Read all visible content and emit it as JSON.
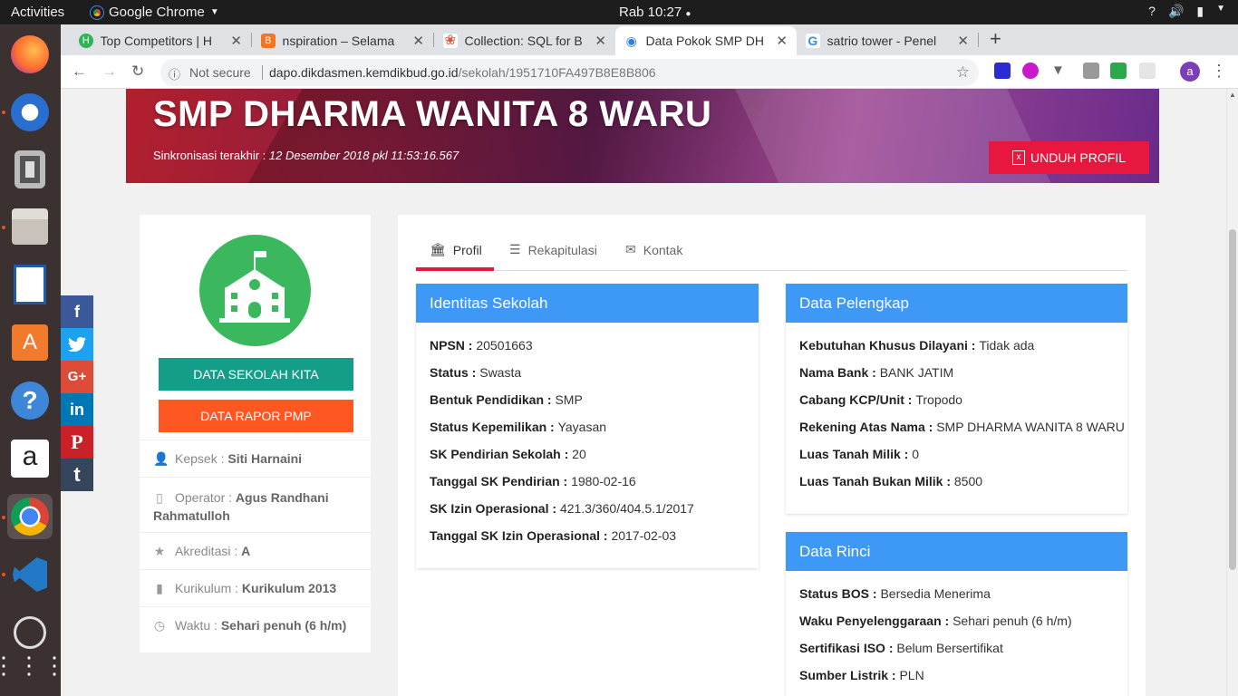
{
  "os": {
    "activities": "Activities",
    "app": "Google Chrome",
    "clock": "Rab 10:27"
  },
  "tabs": [
    {
      "label": "Top Competitors | H",
      "color": "#2cb457",
      "icon": "H"
    },
    {
      "label": "nspiration – Selama",
      "color": "#f47421",
      "icon": "B"
    },
    {
      "label": "Collection: SQL for B",
      "color": "#e0533b",
      "icon": "❀"
    },
    {
      "label": "Data Pokok SMP DH",
      "color": "#2f7de1",
      "icon": "◉"
    },
    {
      "label": "satrio tower - Penel",
      "color": "#4285f4",
      "icon": "G"
    }
  ],
  "omnibox": {
    "security": "Not secure",
    "domain": "dapo.dikdasmen.kemdikbud.go.id",
    "path": "/sekolah/1951710FA497B8E8B806"
  },
  "avatar": "a",
  "hero": {
    "title": "SMP DHARMA WANITA 8 WARU",
    "sync_label": "Sinkronisasi terakhir : ",
    "sync_value": "12 Desember 2018 pkl 11:53:16.567",
    "download": "UNDUH PROFIL"
  },
  "sidebar": {
    "btn_kita": "DATA SEKOLAH KITA",
    "btn_kita_color": "#149e8a",
    "btn_rapor": "DATA RAPOR PMP",
    "btn_rapor_color": "#ff5722",
    "items": [
      {
        "label": "Kepsek : ",
        "value": "Siti Harnaini",
        "icon": "user-icon"
      },
      {
        "label": "Operator : ",
        "value": "Agus Randhani Rahmatulloh",
        "icon": "mobile-icon"
      },
      {
        "label": "Akreditasi : ",
        "value": "A",
        "icon": "star-icon"
      },
      {
        "label": "Kurikulum : ",
        "value": "Kurikulum 2013",
        "icon": "book-icon"
      },
      {
        "label": "Waktu : ",
        "value": "Sehari penuh (6 h/m)",
        "icon": "clock-icon"
      }
    ]
  },
  "main_tabs": [
    {
      "label": "Profil"
    },
    {
      "label": "Rekapitulasi"
    },
    {
      "label": "Kontak"
    }
  ],
  "identitas": {
    "title": "Identitas Sekolah",
    "rows": [
      {
        "k": "NPSN : ",
        "v": "20501663"
      },
      {
        "k": "Status : ",
        "v": "Swasta"
      },
      {
        "k": "Bentuk Pendidikan : ",
        "v": "SMP"
      },
      {
        "k": "Status Kepemilikan : ",
        "v": "Yayasan"
      },
      {
        "k": "SK Pendirian Sekolah : ",
        "v": "20"
      },
      {
        "k": "Tanggal SK Pendirian : ",
        "v": "1980-02-16"
      },
      {
        "k": "SK Izin Operasional : ",
        "v": "421.3/360/404.5.1/2017"
      },
      {
        "k": "Tanggal SK Izin Operasional : ",
        "v": "2017-02-03"
      }
    ]
  },
  "pelengkap": {
    "title": "Data Pelengkap",
    "rows": [
      {
        "k": "Kebutuhan Khusus Dilayani : ",
        "v": "Tidak ada"
      },
      {
        "k": "Nama Bank : ",
        "v": "BANK JATIM"
      },
      {
        "k": "Cabang KCP/Unit : ",
        "v": "Tropodo"
      },
      {
        "k": "Rekening Atas Nama : ",
        "v": "SMP DHARMA WANITA 8 WARU"
      },
      {
        "k": "Luas Tanah Milik : ",
        "v": "0"
      },
      {
        "k": "Luas Tanah Bukan Milik : ",
        "v": "8500"
      }
    ]
  },
  "rinci": {
    "title": "Data Rinci",
    "rows": [
      {
        "k": "Status BOS : ",
        "v": "Bersedia Menerima"
      },
      {
        "k": "Waku Penyelenggaraan : ",
        "v": "Sehari penuh (6 h/m)"
      },
      {
        "k": "Sertifikasi ISO : ",
        "v": "Belum Bersertifikat"
      },
      {
        "k": "Sumber Listrik : ",
        "v": "PLN"
      }
    ]
  },
  "share": [
    {
      "label": "f",
      "color": "#3b5998",
      "name": "facebook"
    },
    {
      "label": "🐦",
      "color": "#1da1f2",
      "name": "twitter"
    },
    {
      "label": "G+",
      "color": "#dd4b39",
      "name": "google-plus"
    },
    {
      "label": "in",
      "color": "#0077b5",
      "name": "linkedin"
    },
    {
      "label": "P",
      "color": "#cb2027",
      "name": "pinterest"
    },
    {
      "label": "t",
      "color": "#35465c",
      "name": "tumblr"
    }
  ]
}
